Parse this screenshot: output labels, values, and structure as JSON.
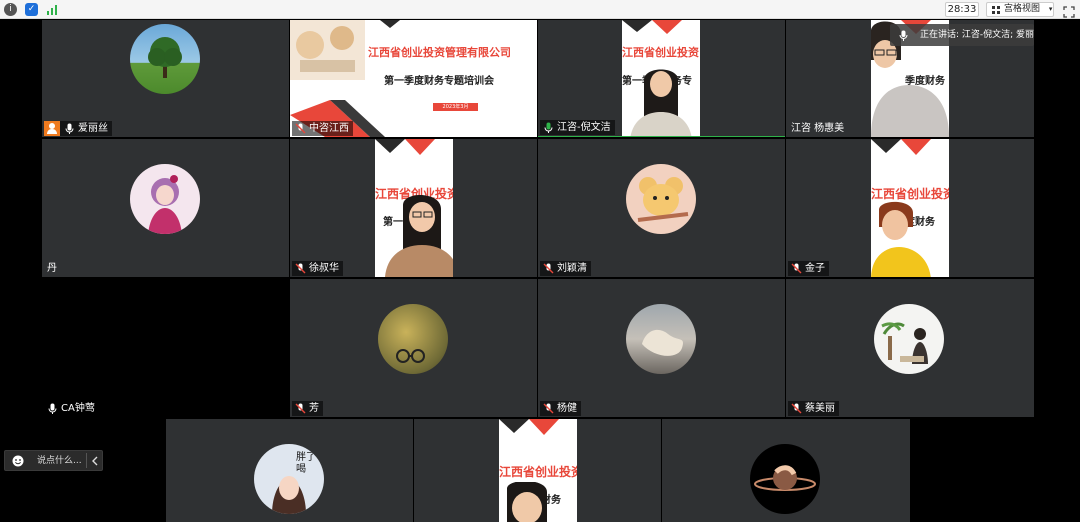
{
  "topbar": {
    "timer": "28:33",
    "view_label": "宫格视图",
    "view_caret": "▾"
  },
  "speaking": {
    "text": "正在讲话: 江咨-倪文洁; 爱丽丝;"
  },
  "slide": {
    "title": "江西省创业投资管理有限公司",
    "subtitle": "第一季度财务专题培训会",
    "date": "2023年3月"
  },
  "tiles": [
    {
      "name": "爱丽丝"
    },
    {
      "name": "中咨江西"
    },
    {
      "name": "江咨-倪文洁"
    },
    {
      "name": "江咨 杨惠美"
    },
    {
      "name": "丹"
    },
    {
      "name": "徐叔华"
    },
    {
      "name": "刘颖清"
    },
    {
      "name": "金子"
    },
    {
      "name": "CA钟莺"
    },
    {
      "name": "芳"
    },
    {
      "name": "杨健"
    },
    {
      "name": "蔡美丽"
    }
  ],
  "chat": {
    "placeholder": "说点什么..."
  },
  "colors": {
    "tile_bg": "#2f3133",
    "accent_red": "#e8473a",
    "speaking_green": "#2fb24a"
  }
}
